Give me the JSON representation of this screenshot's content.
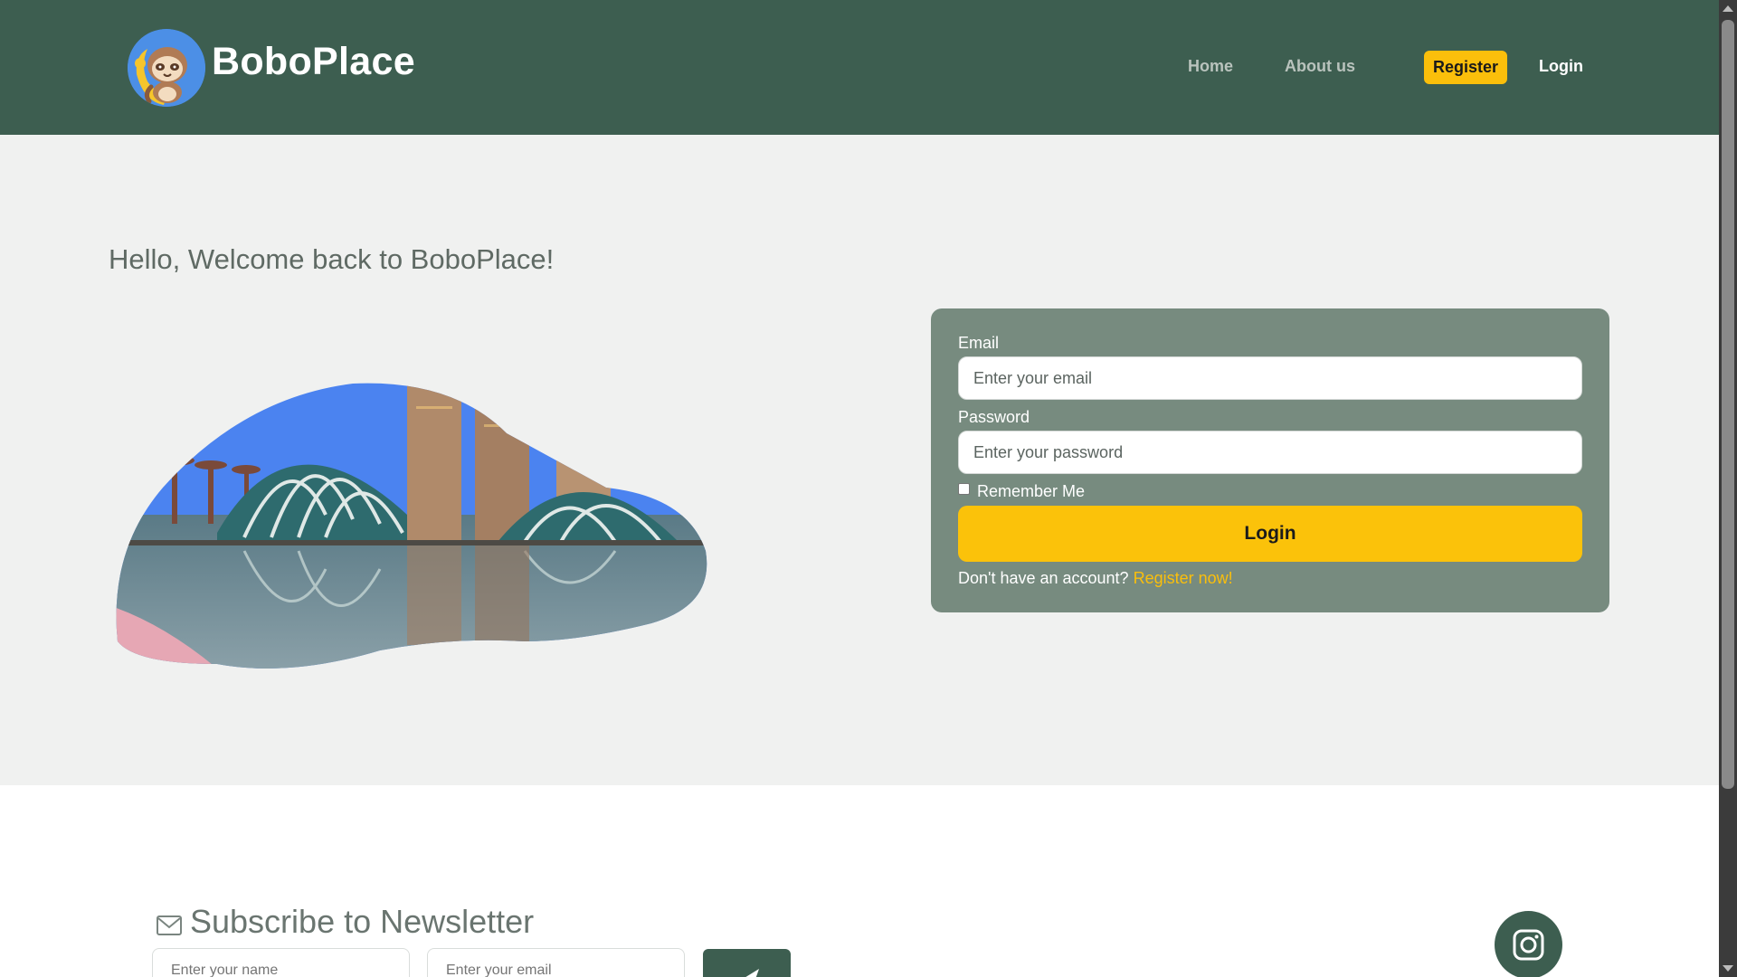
{
  "header": {
    "brand": "BoboPlace",
    "nav": {
      "home": "Home",
      "about": "About us",
      "register": "Register",
      "login": "Login"
    }
  },
  "hero": {
    "welcome": "Hello, Welcome back to BoboPlace!"
  },
  "login_form": {
    "email_label": "Email",
    "email_placeholder": "Enter your email",
    "password_label": "Password",
    "password_placeholder": "Enter your password",
    "remember_label": "Remember Me",
    "submit_label": "Login",
    "no_account_text": "Don't have an account?",
    "register_link": "Register now!"
  },
  "newsletter": {
    "title": "Subscribe to Newsletter",
    "name_placeholder": "Enter your name",
    "email_placeholder": "Enter your email"
  },
  "colors": {
    "header_bg": "#3d5e50",
    "accent": "#fbbf0b",
    "card_bg": "#778b7f"
  },
  "icons": {
    "logo": "sloth-logo-icon",
    "mail": "mail-icon",
    "send": "send-icon",
    "instagram": "instagram-icon"
  }
}
